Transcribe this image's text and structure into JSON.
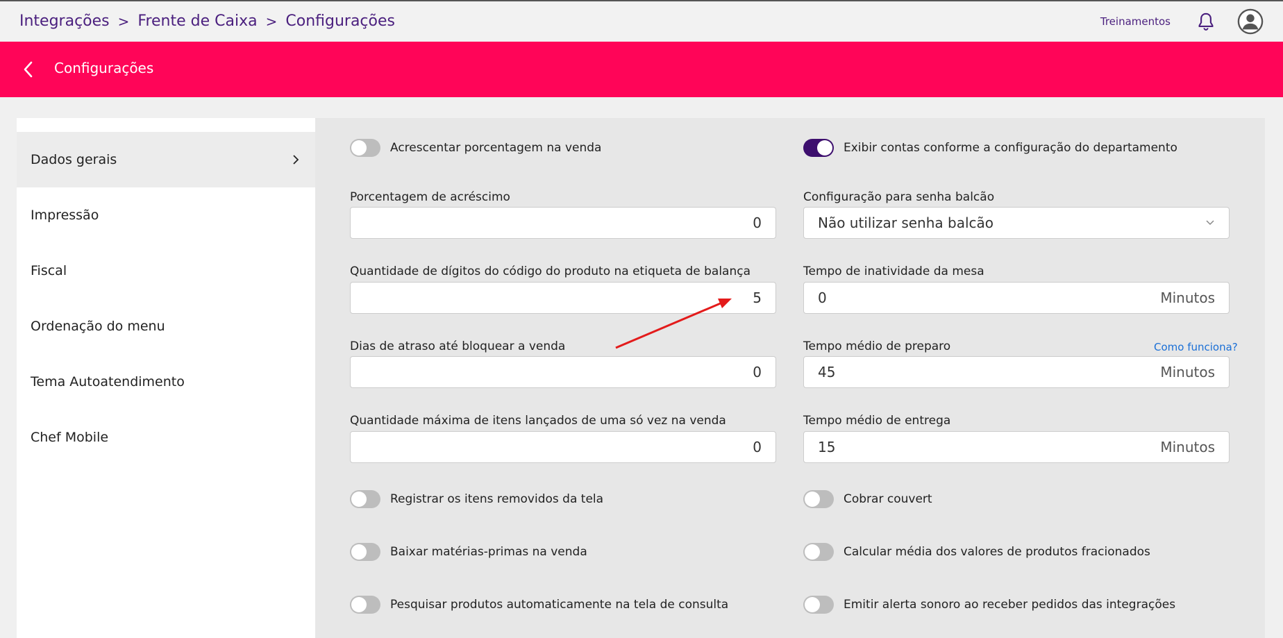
{
  "breadcrumb": {
    "items": [
      "Integrações",
      "Frente de Caixa",
      "Configurações"
    ],
    "separator": ">"
  },
  "header": {
    "training_link": "Treinamentos",
    "icons": [
      "bell-icon",
      "user-avatar-icon"
    ]
  },
  "titlebar": {
    "title": "Configurações",
    "color": "#ff0558"
  },
  "sidebar": {
    "items": [
      {
        "label": "Dados gerais",
        "active": true
      },
      {
        "label": "Impressão"
      },
      {
        "label": "Fiscal"
      },
      {
        "label": "Ordenação do menu"
      },
      {
        "label": "Tema Autoatendimento"
      },
      {
        "label": "Chef Mobile"
      }
    ]
  },
  "settings": {
    "acrescentar_porcentagem": {
      "label": "Acrescentar porcentagem na venda",
      "on": false
    },
    "exibir_contas": {
      "label": "Exibir contas conforme a configuração do departamento",
      "on": true
    },
    "porcentagem_acrescimo": {
      "label": "Porcentagem de acréscimo",
      "value": "0"
    },
    "senha_balcao": {
      "label": "Configuração para senha balcão",
      "value": "Não utilizar senha balcão"
    },
    "digitos_codigo": {
      "label": "Quantidade de dígitos do código do produto na etiqueta de balança",
      "value": "5"
    },
    "inatividade_mesa": {
      "label": "Tempo de inatividade da mesa",
      "value": "0",
      "suffix": "Minutos"
    },
    "dias_atraso": {
      "label": "Dias de atraso até bloquear a venda",
      "value": "0"
    },
    "tempo_preparo": {
      "label": "Tempo médio de preparo",
      "value": "45",
      "suffix": "Minutos",
      "help": "Como funciona?"
    },
    "qtd_maxima_itens": {
      "label": "Quantidade máxima de itens lançados de uma só vez na venda",
      "value": "0"
    },
    "tempo_entrega": {
      "label": "Tempo médio de entrega",
      "value": "15",
      "suffix": "Minutos"
    },
    "registrar_removidos": {
      "label": "Registrar os itens removidos da tela",
      "on": false
    },
    "cobrar_couvert": {
      "label": "Cobrar couvert",
      "on": false
    },
    "baixar_materias": {
      "label": "Baixar matérias-primas na venda",
      "on": false
    },
    "calcular_media": {
      "label": "Calcular média dos valores de produtos fracionados",
      "on": false
    },
    "pesquisar_auto": {
      "label": "Pesquisar produtos automaticamente na tela de consulta",
      "on": false
    },
    "alerta_sonoro": {
      "label": "Emitir alerta sonoro ao receber pedidos das integrações",
      "on": false
    }
  },
  "colors": {
    "accent_purple": "#4a1f7e",
    "toggle_on": "#3d0f6e",
    "annotation_arrow": "#e31b1b",
    "link_blue": "#1a6fd6"
  }
}
